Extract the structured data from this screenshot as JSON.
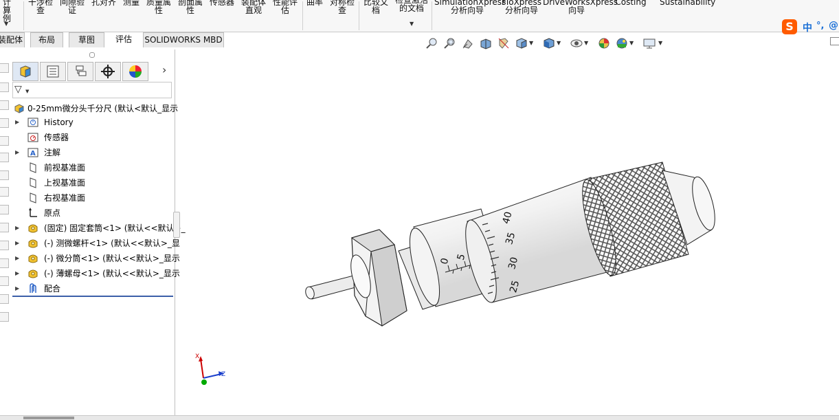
{
  "ribbon": {
    "items": [
      {
        "label": "计算\n例"
      },
      {
        "label": "干涉检\n查"
      },
      {
        "label": "间隙验\n证"
      },
      {
        "label": "孔对齐"
      },
      {
        "label": "测量"
      },
      {
        "label": "质量属\n性"
      },
      {
        "label": "剖面属\n性"
      },
      {
        "label": "传感器"
      },
      {
        "label": "装配体\n直观"
      },
      {
        "label": "性能评\n估"
      },
      {
        "label": "曲率"
      },
      {
        "label": "对称检\n查"
      },
      {
        "label": "比较文\n档"
      },
      {
        "label": "检查激活\n的文档"
      },
      {
        "label": "SimulationXpress\n分析向导"
      },
      {
        "label": "FloXpress\n分析向导"
      },
      {
        "label": "DriveWorksXpress\n向导"
      },
      {
        "label": "Costing"
      },
      {
        "label": "Sustainability"
      }
    ]
  },
  "tabs": [
    {
      "label": "装配体",
      "active": false
    },
    {
      "label": "布局",
      "active": false
    },
    {
      "label": "草图",
      "active": false
    },
    {
      "label": "评估",
      "active": true
    },
    {
      "label": "SOLIDWORKS MBD",
      "active": false
    }
  ],
  "sogou": {
    "logo": "S",
    "lang": "中",
    "punct": "°,",
    "icon": "@"
  },
  "feature_manager": {
    "tab_icons": [
      "feature-manager-icon",
      "property-manager-icon",
      "configuration-manager-icon",
      "dimxpert-icon",
      "display-manager-icon"
    ],
    "tree": [
      {
        "label": "0-25mm微分头千分尺  (默认<默认_显示",
        "icon": "assembly-icon",
        "expand": false,
        "level": 0
      },
      {
        "label": "History",
        "icon": "history-icon",
        "expand": true,
        "level": 1
      },
      {
        "label": "传感器",
        "icon": "sensor-icon",
        "expand": false,
        "level": 1
      },
      {
        "label": "注解",
        "icon": "annotation-icon",
        "expand": true,
        "level": 1
      },
      {
        "label": "前视基准面",
        "icon": "plane-icon",
        "expand": false,
        "level": 1
      },
      {
        "label": "上视基准面",
        "icon": "plane-icon",
        "expand": false,
        "level": 1
      },
      {
        "label": "右视基准面",
        "icon": "plane-icon",
        "expand": false,
        "level": 1
      },
      {
        "label": "原点",
        "icon": "origin-icon",
        "expand": false,
        "level": 1
      },
      {
        "label": "(固定) 固定套筒<1> (默认<<默认>_",
        "icon": "part-icon",
        "expand": true,
        "level": 1
      },
      {
        "label": "(-) 测微螺杆<1> (默认<<默认>_显",
        "icon": "part-icon",
        "expand": true,
        "level": 1
      },
      {
        "label": "(-) 微分筒<1> (默认<<默认>_显示",
        "icon": "part-icon",
        "expand": true,
        "level": 1
      },
      {
        "label": "(-) 薄螺母<1> (默认<<默认>_显示",
        "icon": "part-icon",
        "expand": true,
        "level": 1
      },
      {
        "label": "配合",
        "icon": "mates-icon",
        "expand": true,
        "level": 1
      }
    ]
  },
  "viewport": {
    "thimble_scale": [
      "40",
      "35",
      "30",
      "25"
    ],
    "sleeve_scale": [
      "0",
      "5"
    ],
    "triad": {
      "x": "X",
      "y": "Y",
      "z": "Z"
    }
  },
  "colors": {
    "accent": "#3c5ea8",
    "triad_x": "#cc0000",
    "triad_y": "#00aa00",
    "triad_z": "#1a3fcc",
    "sogou": "#ff5b00"
  }
}
